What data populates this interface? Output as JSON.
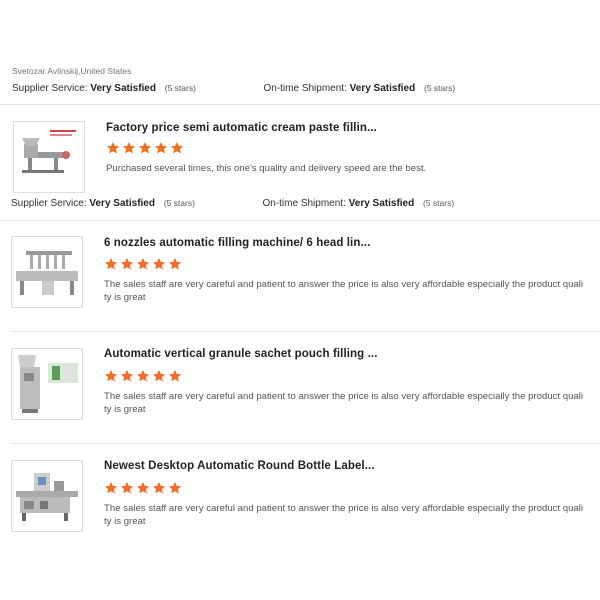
{
  "reviewer": "Svetozar Avlinskij,United States",
  "labels": {
    "supplier_service": "Supplier Service:",
    "on_time_shipment": "On-time Shipment:",
    "very_satisfied": "Very Satisfied",
    "five_stars": "(5 stars)"
  },
  "colors": {
    "star": "#f26f21",
    "divider": "#e3e3e3"
  },
  "products": [
    {
      "title": "Factory price semi automatic cream paste fillin...",
      "rating": 5,
      "review": "Purchased several times, this one's quality and delivery speed are the best.",
      "thumb_icon": "cream-filler-machine-icon"
    },
    {
      "title": "6 nozzles automatic filling machine/ 6 head lin...",
      "rating": 5,
      "review": "The sales staff are very careful and patient to answer the price is also very affordable especially the product quality is great",
      "thumb_icon": "filling-line-machine-icon"
    },
    {
      "title": "Automatic vertical granule sachet pouch filling ...",
      "rating": 5,
      "review": "The sales staff are very careful and patient to answer the price is also very affordable especially the product quality is great",
      "thumb_icon": "sachet-packing-machine-icon"
    },
    {
      "title": "Newest Desktop Automatic Round Bottle Label...",
      "rating": 5,
      "review": "The sales staff are very careful and patient to answer the price is also very affordable especially the product quality is great",
      "thumb_icon": "bottle-labeler-machine-icon"
    }
  ]
}
